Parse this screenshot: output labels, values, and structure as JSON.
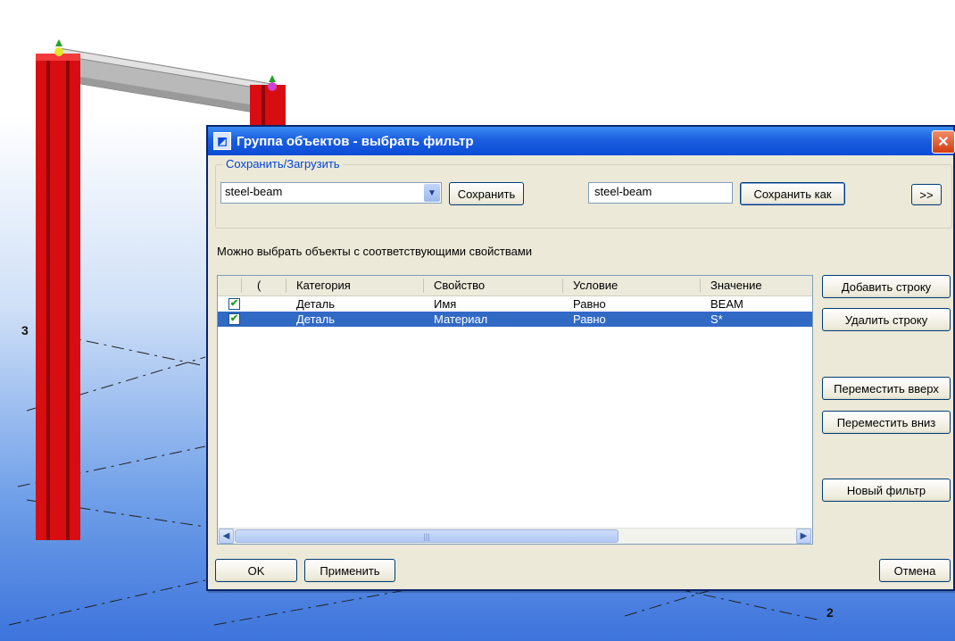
{
  "viewport": {
    "grid_labels": [
      "3",
      "2"
    ]
  },
  "dialog": {
    "title": "Группа объектов - выбрать фильтр",
    "close_glyph": "✕",
    "group_legend": "Сохранить/Загрузить",
    "filter_select_value": "steel-beam",
    "save_label": "Сохранить",
    "save_as_name": "steel-beam",
    "save_as_label": "Сохранить как",
    "expand_label": ">>",
    "hint": "Можно выбрать объекты с соответствующими свойствами",
    "table": {
      "columns": [
        "(",
        "Категория",
        "Свойство",
        "Условие",
        "Значение"
      ],
      "rows": [
        {
          "checked": true,
          "category": "Деталь",
          "property": "Имя",
          "condition": "Равно",
          "value": "BEAM"
        },
        {
          "checked": true,
          "category": "Деталь",
          "property": "Материал",
          "condition": "Равно",
          "value": "S*"
        }
      ],
      "check_glyph": "✔",
      "scroll_left": "◀",
      "scroll_right": "▶",
      "thumb_grip": "|||"
    },
    "side_buttons": {
      "add_row": "Добавить строку",
      "delete_row": "Удалить строку",
      "move_up": "Переместить вверх",
      "move_down": "Переместить вниз",
      "new_filter": "Новый фильтр"
    },
    "ok_label": "OK",
    "apply_label": "Применить",
    "cancel_label": "Отмена"
  },
  "colors": {
    "column_red": "#d80d12",
    "selection": "#316ac5",
    "title_blue": "#0a4bd6"
  }
}
